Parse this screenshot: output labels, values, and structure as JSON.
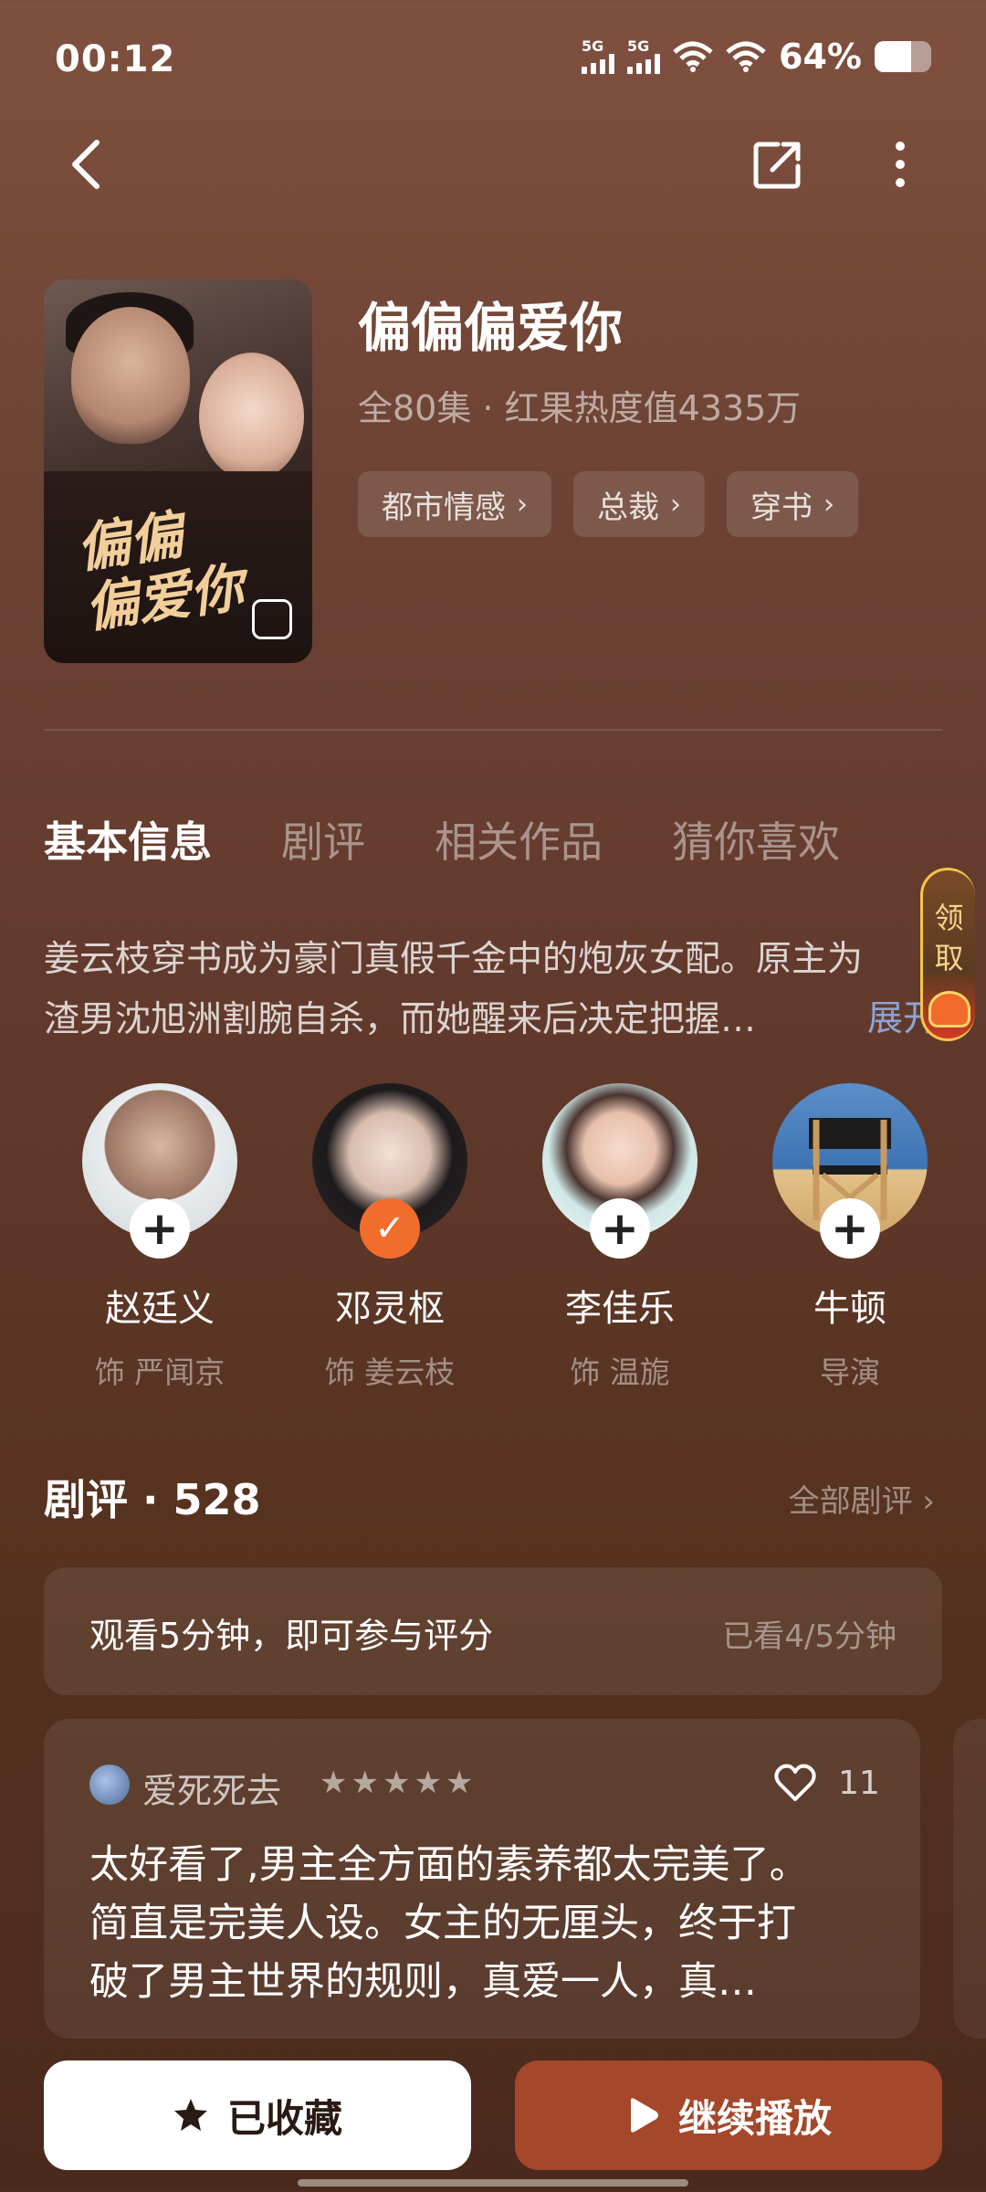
{
  "status_bar": {
    "time": "00:12",
    "network1": "5G",
    "network2": "5G",
    "battery": "64%"
  },
  "show": {
    "title": "偏偏偏爱你",
    "meta": "全80集 · 红果热度值4335万",
    "poster_title": "偏偏\n偏爱你",
    "tags": [
      {
        "label": "都市情感"
      },
      {
        "label": "总裁"
      },
      {
        "label": "穿书"
      }
    ]
  },
  "tabs": [
    {
      "label": "基本信息"
    },
    {
      "label": "剧评"
    },
    {
      "label": "相关作品"
    },
    {
      "label": "猜你喜欢"
    }
  ],
  "synopsis": {
    "line1": "姜云枝穿书成为豪门真假千金中的炮灰女配。原主为",
    "line2": "渣男沈旭洲割腕自杀，而她醒来后决定把握…",
    "expand": "展开"
  },
  "reward": {
    "label1": "领",
    "label2": "取"
  },
  "cast": [
    {
      "name": "赵廷义",
      "role": "饰 严闻京",
      "followed": false
    },
    {
      "name": "邓灵枢",
      "role": "饰 姜云枝",
      "followed": true
    },
    {
      "name": "李佳乐",
      "role": "饰 温旎",
      "followed": false
    },
    {
      "name": "牛顿",
      "role": "导演",
      "followed": false
    }
  ],
  "reviews": {
    "heading": "剧评 · 528",
    "all_label": "全部剧评",
    "rate_prompt": "观看5分钟，即可参与评分",
    "rate_progress": "已看4/5分钟",
    "first": {
      "user": "爱死死去",
      "stars": 5,
      "likes": "11",
      "line1": "太好看了,男主全方面的素养都太完美了。",
      "line2": "简直是完美人设。女主的无厘头，终于打",
      "line3": "破了男主世界的规则，真爱一人，真…"
    }
  },
  "actions": {
    "collect": "已收藏",
    "play": "继续播放"
  },
  "colors": {
    "accent": "#f26c2c",
    "play_button": "#a4472a",
    "link": "#8aa6d6"
  }
}
